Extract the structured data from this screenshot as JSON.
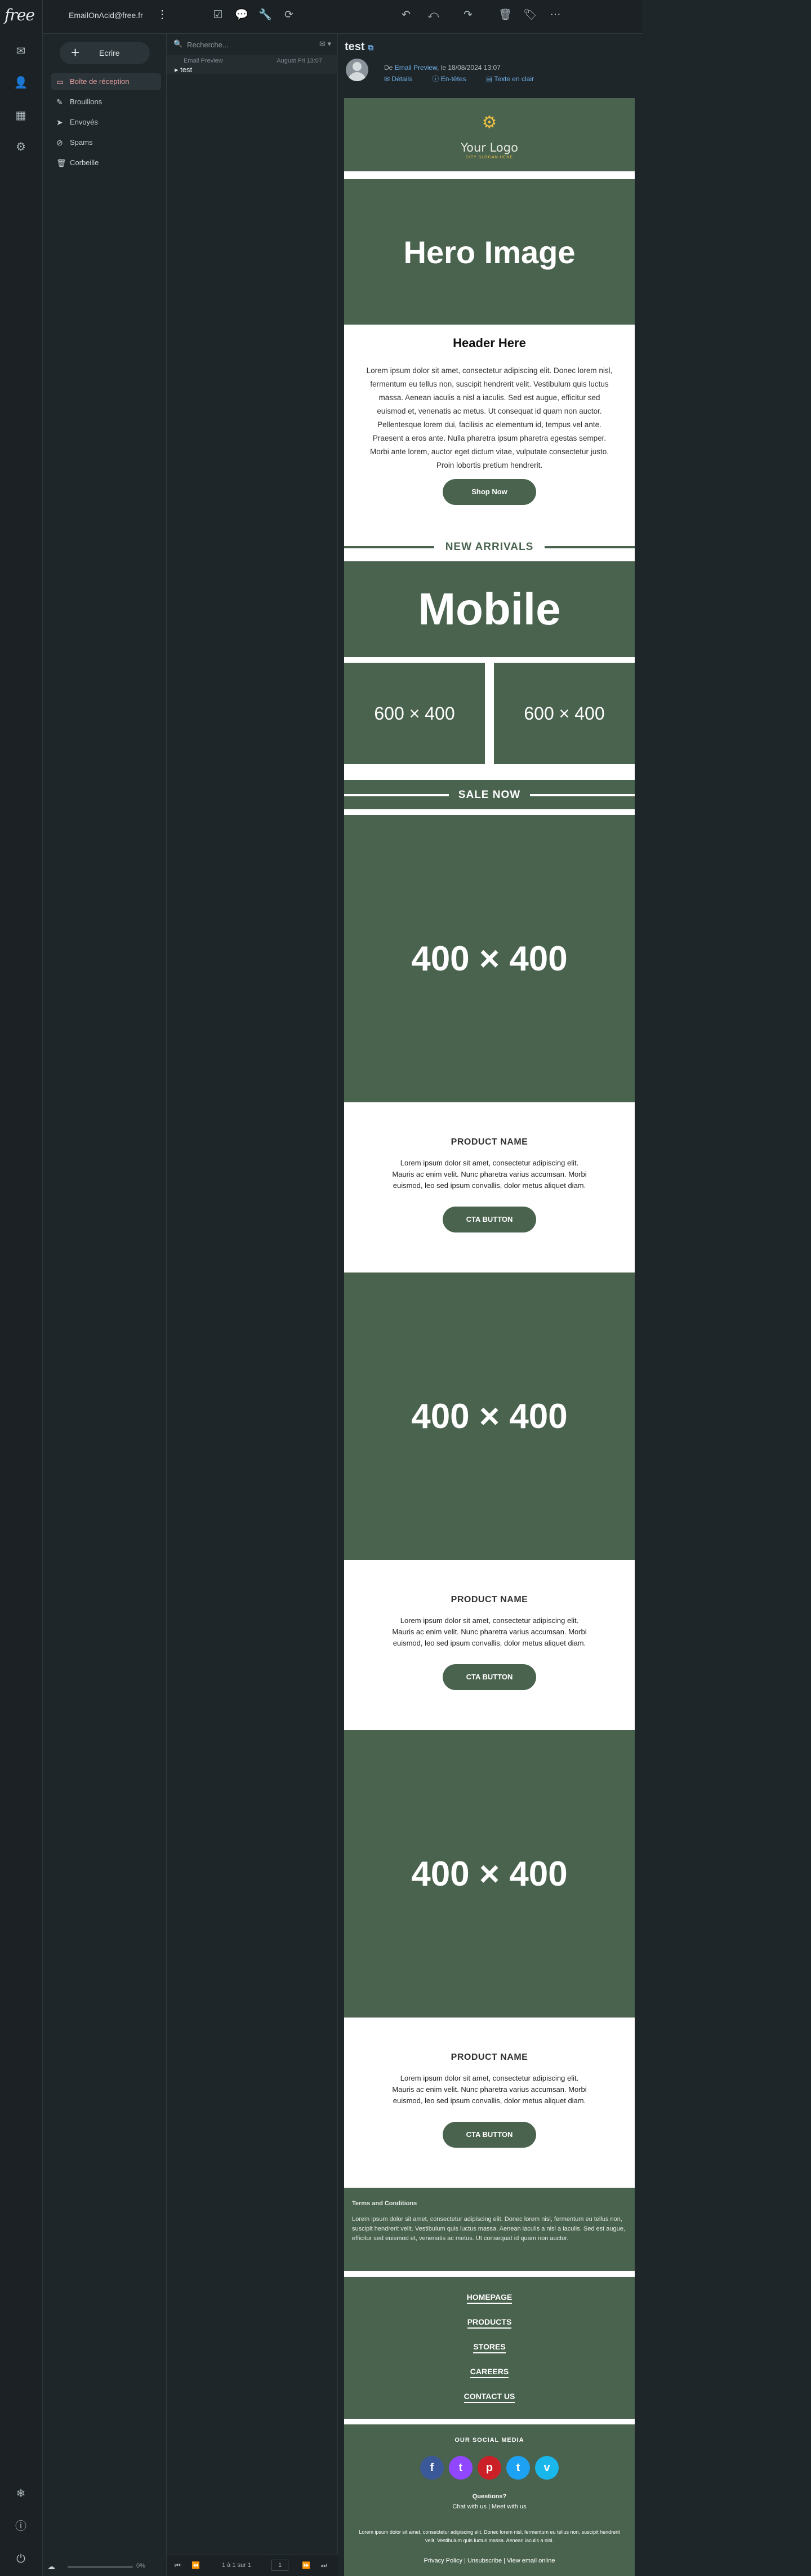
{
  "app": {
    "logo": "free",
    "account": "EmailOnAcid@free.fr",
    "menu_glyph": "⋮"
  },
  "rail": {
    "icons": [
      "mail-icon",
      "contacts-icon",
      "calendar-icon",
      "settings-icon"
    ],
    "bottom_icons": [
      "snowflake-icon",
      "info-icon",
      "power-icon"
    ]
  },
  "toolbar": {
    "left_icons": [
      "select-all-icon",
      "comment-icon",
      "tools-icon",
      "refresh-icon"
    ],
    "right_icons": [
      "reply-icon",
      "reply-all-icon",
      "forward-icon",
      "delete-icon",
      "tag-icon",
      "more-icon"
    ]
  },
  "compose": {
    "label": "Ecrire"
  },
  "folders": [
    {
      "label": "Boîte de réception",
      "icon": "inbox-icon",
      "active": true
    },
    {
      "label": "Brouillons",
      "icon": "pencil-icon",
      "active": false
    },
    {
      "label": "Envoyés",
      "icon": "send-icon",
      "active": false
    },
    {
      "label": "Spams",
      "icon": "spam-icon",
      "active": false
    },
    {
      "label": "Corbeille",
      "icon": "trash-icon",
      "active": false
    }
  ],
  "list": {
    "search_placeholder": "Recherche...",
    "message": {
      "sender": "Email Preview",
      "date": "August Fri 13:07",
      "subject": "test"
    },
    "footer": {
      "page_info": "1 à 1 sur 1",
      "page_number": "1",
      "zoom": "0%"
    }
  },
  "reader": {
    "subject": "test",
    "from_prefix": "De",
    "from_name": "Email Preview",
    "date_text": ", le 18/08/2024 13:07",
    "actions": [
      "Détails",
      "En-têtes",
      "Texte en clair"
    ]
  },
  "email": {
    "logo_text": "Your Logo",
    "logo_tagline": "CITY SLOGAN HERE",
    "hero": "Hero Image",
    "header": "Header Here",
    "body": "Lorem ipsum dolor sit amet, consectetur adipiscing elit. Donec lorem nisl, fermentum eu tellus non, suscipit hendrerit velit. Vestibulum quis luctus massa. Aenean iaculis a nisl a iaculis. Sed est augue, efficitur sed euismod et, venenatis ac metus. Ut consequat id quam non auctor. Pellentesque lorem dui, facilisis ac elementum id, tempus vel ante. Praesent a eros ante. Nulla pharetra ipsum pharetra egestas semper. Morbi ante lorem, auctor eget dictum vitae, vulputate consectetur justo. Proin lobortis pretium hendrerit.",
    "shop_now": "Shop Now",
    "new_arrivals": "NEW ARRIVALS",
    "mobile": "Mobile",
    "col_left": "600 × 400",
    "col_right": "600 × 400",
    "sale_now": "SALE NOW",
    "products": [
      {
        "image": "400 × 400",
        "name": "PRODUCT NAME",
        "desc": "Lorem ipsum dolor sit amet, consectetur adipiscing elit. Mauris ac enim velit. Nunc pharetra varius accumsan. Morbi euismod, leo sed ipsum convallis, dolor metus aliquet diam.",
        "cta": "CTA BUTTON"
      },
      {
        "image": "400 × 400",
        "name": "PRODUCT NAME",
        "desc": "Lorem ipsum dolor sit amet, consectetur adipiscing elit. Mauris ac enim velit. Nunc pharetra varius accumsan. Morbi euismod, leo sed ipsum convallis, dolor metus aliquet diam.",
        "cta": "CTA BUTTON"
      },
      {
        "image": "400 × 400",
        "name": "PRODUCT NAME",
        "desc": "Lorem ipsum dolor sit amet, consectetur adipiscing elit. Mauris ac enim velit. Nunc pharetra varius accumsan. Morbi euismod, leo sed ipsum convallis, dolor metus aliquet diam.",
        "cta": "CTA BUTTON"
      }
    ],
    "terms_title": "Terms and Conditions",
    "terms_body": "Lorem ipsum dolor sit amet, consectetur adipiscing elit. Donec lorem nisl, fermentum eu tellus non, suscipit hendrerit velit. Vestibulum quis luctus massa. Aenean iaculis a nisl a iaculis. Sed est augue, efficitur sed euismod et, venenatis ac metus. Ut consequat id quam non auctor.",
    "nav_links": [
      "HOMEPAGE",
      "PRODUCTS",
      "STORES",
      "CAREERS",
      "CONTACT US"
    ],
    "social_heading": "OUR SOCIAL MEDIA",
    "social": [
      {
        "icon": "facebook-icon",
        "glyph": "f",
        "color": "#3b5998"
      },
      {
        "icon": "twitch-icon",
        "glyph": "t",
        "color": "#9146ff"
      },
      {
        "icon": "pinterest-icon",
        "glyph": "p",
        "color": "#cb2027"
      },
      {
        "icon": "twitter-icon",
        "glyph": "t",
        "color": "#1da1f2"
      },
      {
        "icon": "vimeo-icon",
        "glyph": "v",
        "color": "#1ab7ea"
      }
    ],
    "questions": "Questions?",
    "chat_line": "Chat with us | Meet with us",
    "footer_body": "Lorem ipsum dolor sit amet, consectetur adipiscing elit. Donec lorem nisl, fermentum eu tellus non, suscipit hendrerit velit. Vestibulum quis luctus massa. Aenean iaculis a nisl.",
    "footer_links": "Privacy Policy | Unsubscribe | View email online"
  },
  "colors": {
    "email_green": "#4a634e",
    "active_folder": "#e8a0a0",
    "link": "#6fb2ea"
  }
}
